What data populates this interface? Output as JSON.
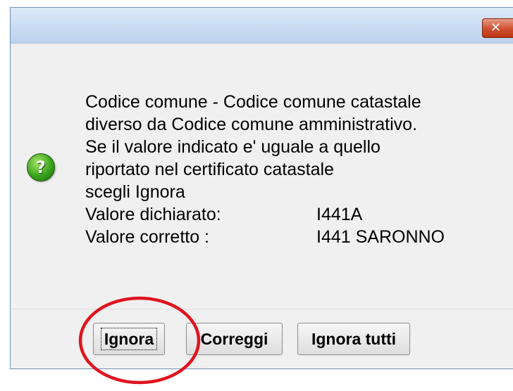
{
  "dialog": {
    "close_glyph": "✕"
  },
  "icon": {
    "name": "question-icon",
    "glyph": "?",
    "color": "#3aa31b"
  },
  "message": {
    "lines": [
      "Codice comune - Codice comune catastale",
      "diverso da Codice comune amministrativo.",
      "Se il valore indicato e' uguale a quello",
      "riportato nel certificato catastale",
      "scegli Ignora"
    ],
    "declared_label": "Valore dichiarato:",
    "declared_value": "I441A",
    "correct_label": "Valore corretto  :",
    "correct_value": "I441 SARONNO"
  },
  "buttons": {
    "ignora": "Ignora",
    "correggi": "Correggi",
    "ignora_tutti": "Ignora tutti"
  },
  "annotation": {
    "highlight_color": "#e0141e"
  }
}
